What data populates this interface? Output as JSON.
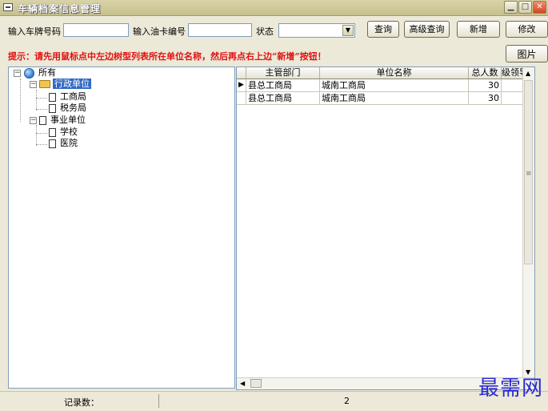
{
  "window": {
    "title": "车辆档案信息管理",
    "controls": [
      "minimize-icon",
      "restore-icon",
      "close-icon"
    ]
  },
  "search": {
    "plate_label": "输入车牌号码",
    "plate_value": "",
    "card_label": "输入油卡编号",
    "card_value": "",
    "status_label": "状态",
    "status_value": ""
  },
  "toolbar": {
    "query_label": "查询",
    "advanced_query_label": "高级查询",
    "new_label": "新增",
    "edit_label": "修改",
    "image_label": "图片"
  },
  "hint": "提示：请先用鼠标点中左边树型列表所在单位名称，然后再点右上边“新增”按钮！",
  "tree": {
    "root": "所有",
    "groups": [
      {
        "label": "行政单位",
        "selected": true,
        "children": [
          "工商局",
          "税务局"
        ]
      },
      {
        "label": "事业单位",
        "selected": false,
        "children": [
          "学校",
          "医院"
        ]
      }
    ]
  },
  "grid": {
    "columns": [
      "主管部门",
      "单位名称",
      "总人数",
      "级领导"
    ],
    "rows": [
      {
        "dept": "县总工商局",
        "unit": "城南工商局",
        "count": "30",
        "lead": ""
      },
      {
        "dept": "县总工商局",
        "unit": "城南工商局",
        "count": "30",
        "lead": ""
      }
    ]
  },
  "statusbar": {
    "record_label": "记录数：",
    "record_count": "2"
  },
  "watermark": "最需网"
}
